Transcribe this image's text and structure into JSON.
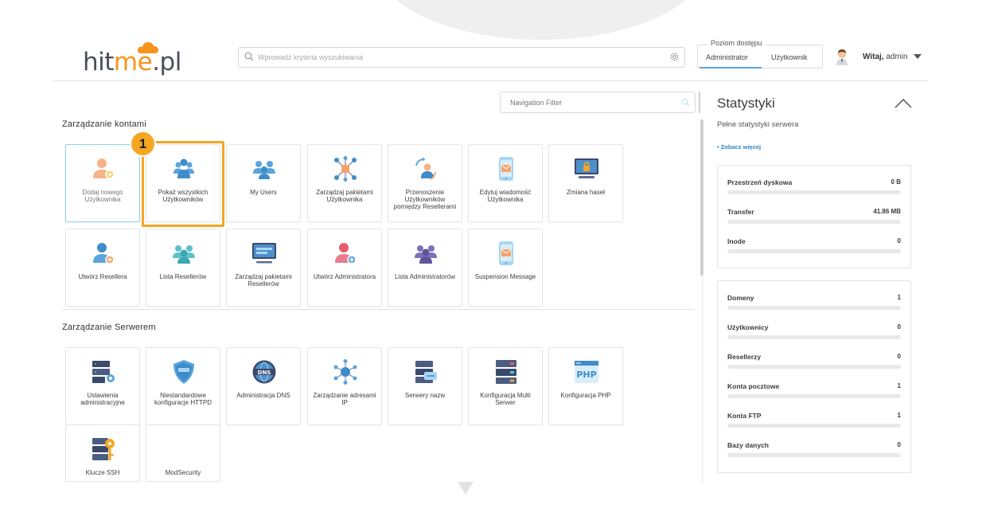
{
  "header": {
    "logo_text_main": "hit",
    "logo_text_accent": "me",
    "logo_text_end": ".pl",
    "search_placeholder": "Wprowadź kryteria wyszukiwania",
    "access_title": "Poziom dostępu",
    "access_admin": "Administrator",
    "access_user": "Użytkownik",
    "greeting_prefix": "Witaj,",
    "greeting_user": "admin"
  },
  "main": {
    "nav_filter_placeholder": "Navigation Filter",
    "sections": [
      {
        "title": "Zarządzanie kontami",
        "tiles": [
          {
            "label": "Dodaj nowego Użytkownika",
            "icon": "add-user-icon"
          },
          {
            "label": "Pokaż wszystkich Użytkowników",
            "icon": "users-group-icon"
          },
          {
            "label": "My Users",
            "icon": "my-users-icon"
          },
          {
            "label": "Zarządzaj pakietami Użytkownika",
            "icon": "package-network-icon"
          },
          {
            "label": "Przenoszenie Użytkowników pomiędzy Resellerami",
            "icon": "transfer-users-icon"
          },
          {
            "label": "Edytuj wiadomość Użytkownika",
            "icon": "mobile-message-icon"
          },
          {
            "label": "Zmiana haseł",
            "icon": "monitor-lock-icon"
          },
          {
            "label": "Utwórz Resellera",
            "icon": "create-reseller-icon"
          },
          {
            "label": "Lista Resellerów",
            "icon": "reseller-list-icon"
          },
          {
            "label": "Zarządzaj pakietami Resellerów",
            "icon": "reseller-packages-icon"
          },
          {
            "label": "Utwórz Administratora",
            "icon": "create-admin-icon"
          },
          {
            "label": "Lista Administratorów",
            "icon": "admin-list-icon"
          },
          {
            "label": "Suspension Message",
            "icon": "suspension-message-icon"
          }
        ]
      },
      {
        "title": "Zarządzanie Serwerem",
        "tiles": [
          {
            "label": "Ustawienia administracyjne",
            "icon": "server-settings-icon"
          },
          {
            "label": "Niestandardowe konfiguracje HTTPD",
            "icon": "httpd-shield-icon"
          },
          {
            "label": "Administracja DNS",
            "icon": "dns-globe-icon"
          },
          {
            "label": "Zarządzanie adresami IP",
            "icon": "ip-network-icon"
          },
          {
            "label": "Serwery nazw",
            "icon": "name-servers-icon"
          },
          {
            "label": "Konfiguracja Multi Serwer",
            "icon": "multi-server-icon"
          },
          {
            "label": "Konfiguracja PHP",
            "icon": "php-icon"
          },
          {
            "label": "Klucze SSH",
            "icon": "ssh-key-icon"
          },
          {
            "label": "ModSecurity",
            "icon": "modsecurity-icon"
          }
        ]
      }
    ],
    "step_badge": "1"
  },
  "stats": {
    "title": "Statystyki",
    "subtitle": "Pełne statystyki serwera",
    "more_link": "• Zobacz więcej",
    "box1": [
      {
        "name": "Przestrzeń dyskowa",
        "value": "0 B"
      },
      {
        "name": "Transfer",
        "value": "41.86 MB"
      },
      {
        "name": "Inode",
        "value": "0"
      }
    ],
    "box2": [
      {
        "name": "Domeny",
        "value": "1"
      },
      {
        "name": "Użytkownicy",
        "value": "0"
      },
      {
        "name": "Resellerzy",
        "value": "0"
      },
      {
        "name": "Konta pocztowe",
        "value": "1"
      },
      {
        "name": "Konta FTP",
        "value": "1"
      },
      {
        "name": "Bazy danych",
        "value": "0"
      }
    ]
  },
  "colors": {
    "accent_orange": "#f5a623",
    "accent_blue": "#5fa4d8",
    "link_blue": "#2f86c6"
  }
}
